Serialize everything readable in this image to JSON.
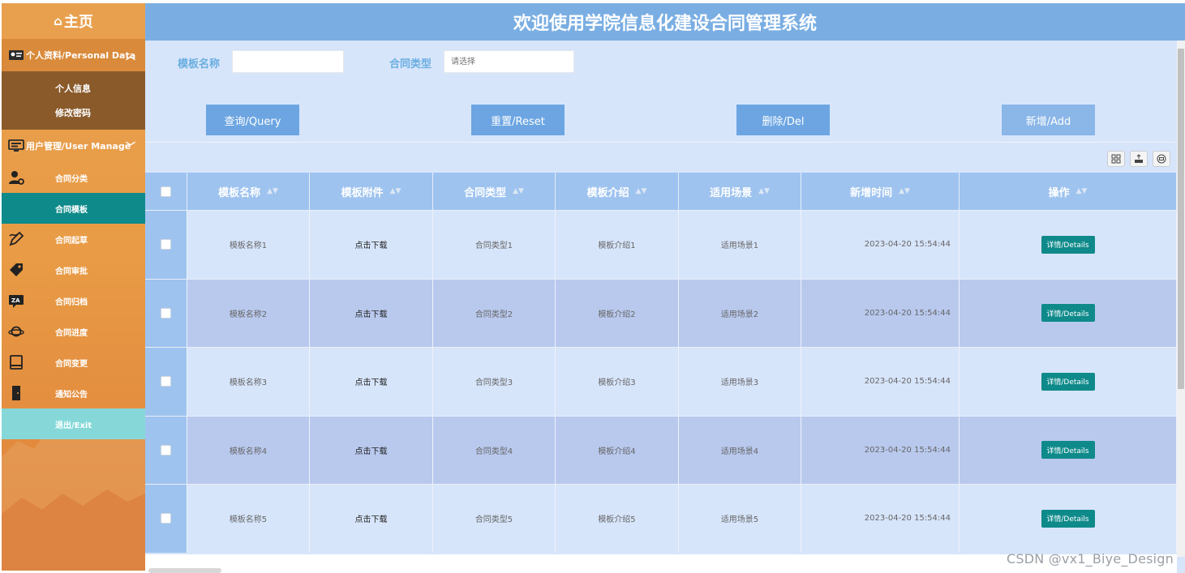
{
  "sidebar": {
    "home": {
      "label": "主页",
      "icon": "home-icon"
    },
    "personal_header": "个人资料/Personal Data",
    "personal_items": [
      "个人信息",
      "修改密码"
    ],
    "user_header": "用户管理/User Manage",
    "menu_items": [
      {
        "label": "合同分类",
        "icon": "user-gear-icon"
      },
      {
        "label": "合同模板",
        "icon": "",
        "active": true
      },
      {
        "label": "合同起草",
        "icon": "pen-icon"
      },
      {
        "label": "合同审批",
        "icon": "tag-icon"
      },
      {
        "label": "合同归档",
        "icon": "translate-icon"
      },
      {
        "label": "合同进度",
        "icon": "planet-icon"
      },
      {
        "label": "合同变更",
        "icon": "book-icon"
      },
      {
        "label": "通知公告",
        "icon": "door-icon"
      },
      {
        "label": "退出/Exit",
        "icon": ""
      }
    ]
  },
  "header": {
    "title": "欢迎使用学院信息化建设合同管理系统"
  },
  "search": {
    "template_name_label": "模板名称",
    "template_name_value": "",
    "contract_type_label": "合同类型",
    "contract_type_placeholder": "请选择"
  },
  "buttons": {
    "query": "查询/Query",
    "reset": "重置/Reset",
    "delete": "删除/Del",
    "add": "新增/Add"
  },
  "table": {
    "columns": [
      "模板名称",
      "模板附件",
      "合同类型",
      "模板介绍",
      "适用场景",
      "新增时间",
      "操作"
    ],
    "rows": [
      {
        "name": "模板名称1",
        "attachment": "点击下载",
        "type": "合同类型1",
        "intro": "模板介绍1",
        "scene": "适用场景1",
        "time": "2023-04-20 15:54:44",
        "action": "详情/Details"
      },
      {
        "name": "模板名称2",
        "attachment": "点击下载",
        "type": "合同类型2",
        "intro": "模板介绍2",
        "scene": "适用场景2",
        "time": "2023-04-20 15:54:44",
        "action": "详情/Details"
      },
      {
        "name": "模板名称3",
        "attachment": "点击下载",
        "type": "合同类型3",
        "intro": "模板介绍3",
        "scene": "适用场景3",
        "time": "2023-04-20 15:54:44",
        "action": "详情/Details"
      },
      {
        "name": "模板名称4",
        "attachment": "点击下载",
        "type": "合同类型4",
        "intro": "模板介绍4",
        "scene": "适用场景4",
        "time": "2023-04-20 15:54:44",
        "action": "详情/Details"
      },
      {
        "name": "模板名称5",
        "attachment": "点击下载",
        "type": "合同类型5",
        "intro": "模板介绍5",
        "scene": "适用场景5",
        "time": "2023-04-20 15:54:44",
        "action": "详情/Details"
      }
    ]
  },
  "watermark": "CSDN @vx1_Biye_Design",
  "colors": {
    "sidebar": "#e99b45",
    "header": "#7aaee3",
    "content_bg": "#d7e5fb",
    "button": "#6ca5e2",
    "active_menu": "#0f8a8a",
    "detail_button": "#0f8a8a"
  }
}
